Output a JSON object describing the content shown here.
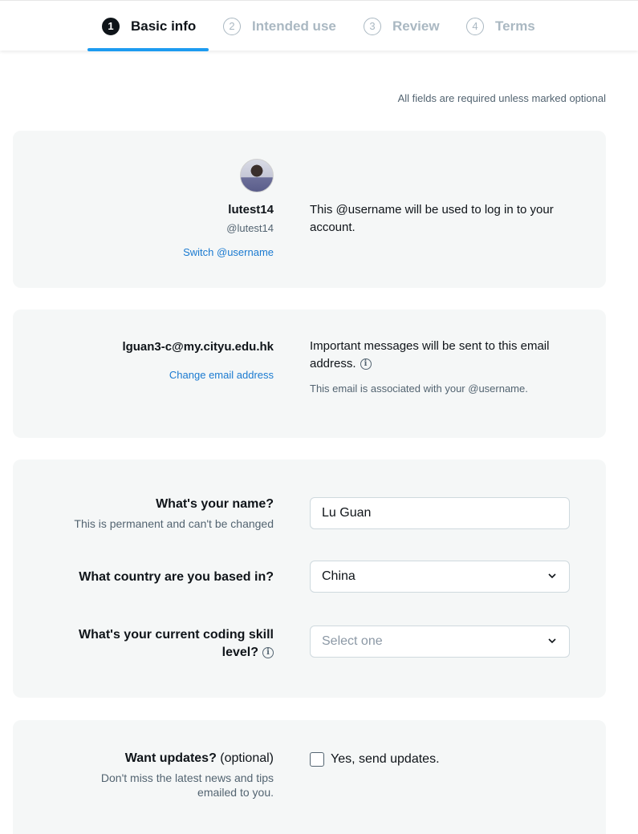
{
  "stepper": {
    "steps": [
      {
        "num": "1",
        "label": "Basic info"
      },
      {
        "num": "2",
        "label": "Intended use"
      },
      {
        "num": "3",
        "label": "Review"
      },
      {
        "num": "4",
        "label": "Terms"
      }
    ]
  },
  "required_note": "All fields are required unless marked optional",
  "account": {
    "display_name": "lutest14",
    "handle": "@lutest14",
    "switch_link": "Switch @username",
    "description": "This @username will be used to log in to your account."
  },
  "email": {
    "address": "lguan3-c@my.cityu.edu.hk",
    "change_link": "Change email address",
    "description": "Important messages will be sent to this email address.",
    "note": "This email is associated with your @username."
  },
  "form": {
    "name_question": "What's your name?",
    "name_hint": "This is permanent and can't be changed",
    "name_value": "Lu Guan",
    "country_question": "What country are you based in?",
    "country_value": "China",
    "skill_question_line1": "What's your current coding skill",
    "skill_question_line2": "level?",
    "skill_placeholder": "Select one"
  },
  "updates": {
    "question": "Want updates?",
    "optional": "(optional)",
    "hint_line1": "Don't miss the latest news and tips",
    "hint_line2": "emailed to you.",
    "checkbox_label": "Yes, send updates."
  }
}
